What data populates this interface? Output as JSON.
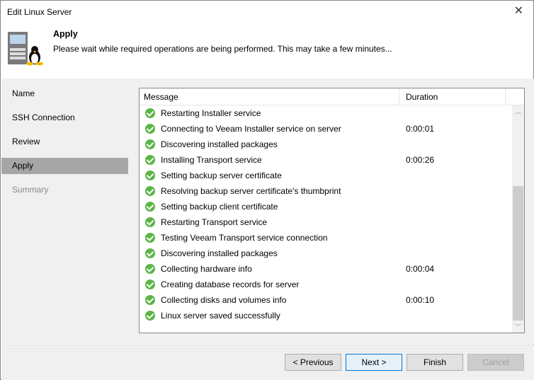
{
  "window": {
    "title": "Edit Linux Server"
  },
  "header": {
    "title": "Apply",
    "subtitle": "Please wait while required operations are being performed. This may take a few minutes..."
  },
  "sidebar": {
    "items": [
      {
        "label": "Name"
      },
      {
        "label": "SSH Connection"
      },
      {
        "label": "Review"
      },
      {
        "label": "Apply"
      },
      {
        "label": "Summary"
      }
    ]
  },
  "table": {
    "columns": [
      "Message",
      "Duration"
    ],
    "rows": [
      {
        "message": "Restarting Installer service",
        "duration": ""
      },
      {
        "message": "Connecting to Veeam Installer service on server",
        "duration": "0:00:01"
      },
      {
        "message": "Discovering installed packages",
        "duration": ""
      },
      {
        "message": "Installing Transport service",
        "duration": "0:00:26"
      },
      {
        "message": "Setting backup server certificate",
        "duration": ""
      },
      {
        "message": "Resolving backup server certificate's thumbprint",
        "duration": ""
      },
      {
        "message": "Setting backup client certificate",
        "duration": ""
      },
      {
        "message": "Restarting Transport service",
        "duration": ""
      },
      {
        "message": "Testing Veeam Transport service connection",
        "duration": ""
      },
      {
        "message": "Discovering installed packages",
        "duration": ""
      },
      {
        "message": "Collecting hardware info",
        "duration": "0:00:04"
      },
      {
        "message": "Creating database records for server",
        "duration": ""
      },
      {
        "message": "Collecting disks and volumes info",
        "duration": "0:00:10"
      },
      {
        "message": "Linux server saved successfully",
        "duration": ""
      }
    ]
  },
  "buttons": {
    "previous": "< Previous",
    "next": "Next >",
    "finish": "Finish",
    "cancel": "Cancel"
  }
}
